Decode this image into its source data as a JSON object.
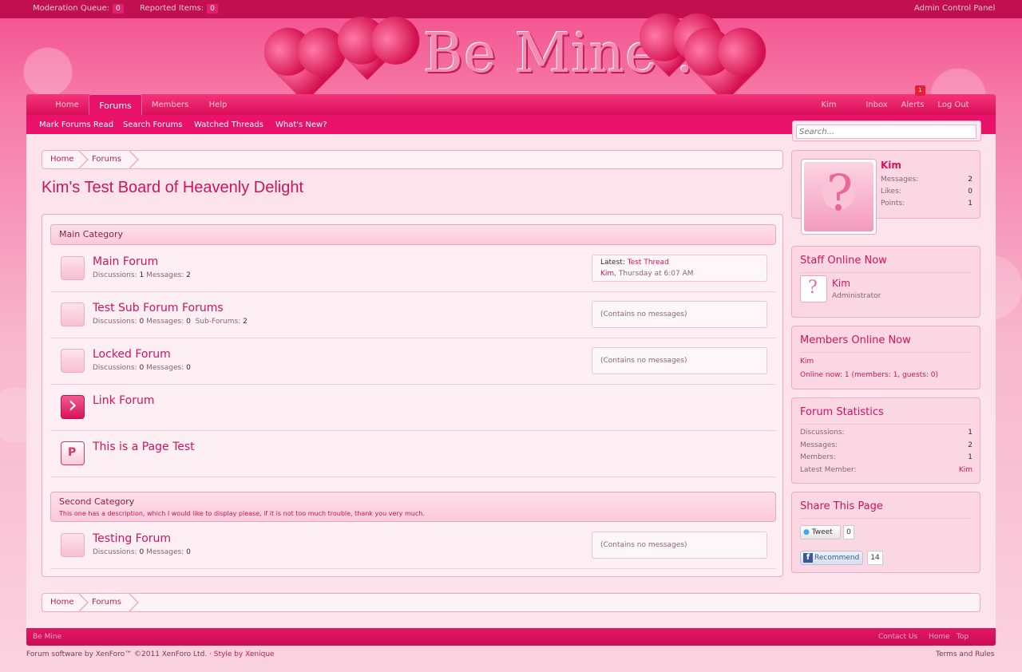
{
  "adminbar": {
    "moderation_label": "Moderation Queue:",
    "moderation_count": "0",
    "reported_label": "Reported Items:",
    "reported_count": "0",
    "admin_cp": "Admin Control Panel"
  },
  "logo": {
    "text": "Be Mine..."
  },
  "nav": {
    "tabs": [
      {
        "label": "Home"
      },
      {
        "label": "Forums",
        "selected": true
      },
      {
        "label": "Members"
      },
      {
        "label": "Help"
      }
    ],
    "user": "Kim",
    "inbox": "Inbox",
    "alerts": "Alerts",
    "alerts_count": "1",
    "logout": "Log Out"
  },
  "subnav": {
    "links": [
      "Mark Forums Read",
      "Search Forums",
      "Watched Threads",
      "What's New?"
    ]
  },
  "search": {
    "placeholder": "Search..."
  },
  "breadcrumb": {
    "items": [
      "Home",
      "Forums"
    ]
  },
  "page_title": "Kim's Test Board of Heavenly Delight",
  "categories": [
    {
      "title": "Main Category",
      "description": "",
      "nodes": [
        {
          "title": "Main Forum",
          "discussions_label": "Discussions:",
          "discussions": "1",
          "messages_label": "Messages:",
          "messages": "2",
          "latest_label": "Latest:",
          "latest_thread": "Test Thread",
          "latest_user": "Kim",
          "latest_time": ", Thursday at 6:07 AM",
          "icon": "forum-icon"
        },
        {
          "title": "Test Sub Forum Forums",
          "discussions_label": "Discussions:",
          "discussions": "0",
          "messages_label": "Messages:",
          "messages": "0",
          "subforums_label": "Sub-Forums:",
          "subforums": "2",
          "latest_none": "(Contains no messages)",
          "icon": "forum-icon"
        },
        {
          "title": "Locked Forum",
          "discussions_label": "Discussions:",
          "discussions": "0",
          "messages_label": "Messages:",
          "messages": "0",
          "latest_none": "(Contains no messages)",
          "icon": "forum-icon"
        },
        {
          "title": "Link Forum",
          "icon": "link-forum-icon"
        },
        {
          "title": "This is a Page Test",
          "icon": "page-icon"
        }
      ]
    },
    {
      "title": "Second Category",
      "description": "This one has a description, which I would like to display please, if it is not too much trouble, thank you very much.",
      "nodes": [
        {
          "title": "Testing Forum",
          "discussions_label": "Discussions:",
          "discussions": "0",
          "messages_label": "Messages:",
          "messages": "0",
          "latest_none": "(Contains no messages)",
          "icon": "forum-icon"
        }
      ]
    }
  ],
  "sidebar": {
    "visitor": {
      "name": "Kim",
      "messages_label": "Messages:",
      "messages": "2",
      "likes_label": "Likes:",
      "likes": "0",
      "points_label": "Points:",
      "points": "1"
    },
    "staff": {
      "title": "Staff Online Now",
      "name": "Kim",
      "role": "Administrator"
    },
    "members_online": {
      "title": "Members Online Now",
      "user": "Kim",
      "summary": "Online now: 1 (members: 1, guests: 0)"
    },
    "stats": {
      "title": "Forum Statistics",
      "discussions_label": "Discussions:",
      "discussions": "1",
      "messages_label": "Messages:",
      "messages": "2",
      "members_label": "Members:",
      "members": "1",
      "latest_label": "Latest Member:",
      "latest": "Kim"
    },
    "share": {
      "title": "Share This Page",
      "tweet": "Tweet",
      "tweet_count": "0",
      "recommend": "Recommend",
      "recommend_count": "14"
    }
  },
  "footer": {
    "style_name": "Be Mine",
    "links": [
      "Contact Us",
      "Home",
      "Top"
    ],
    "copyright": "Forum software by XenForo™ ©2011 XenForo Ltd.",
    "style_by": "· Style by Xenique",
    "terms": "Terms and Rules"
  },
  "colors": {
    "accent": "#d1145a",
    "nav": "#e8126a",
    "panel": "#fce3ec"
  }
}
